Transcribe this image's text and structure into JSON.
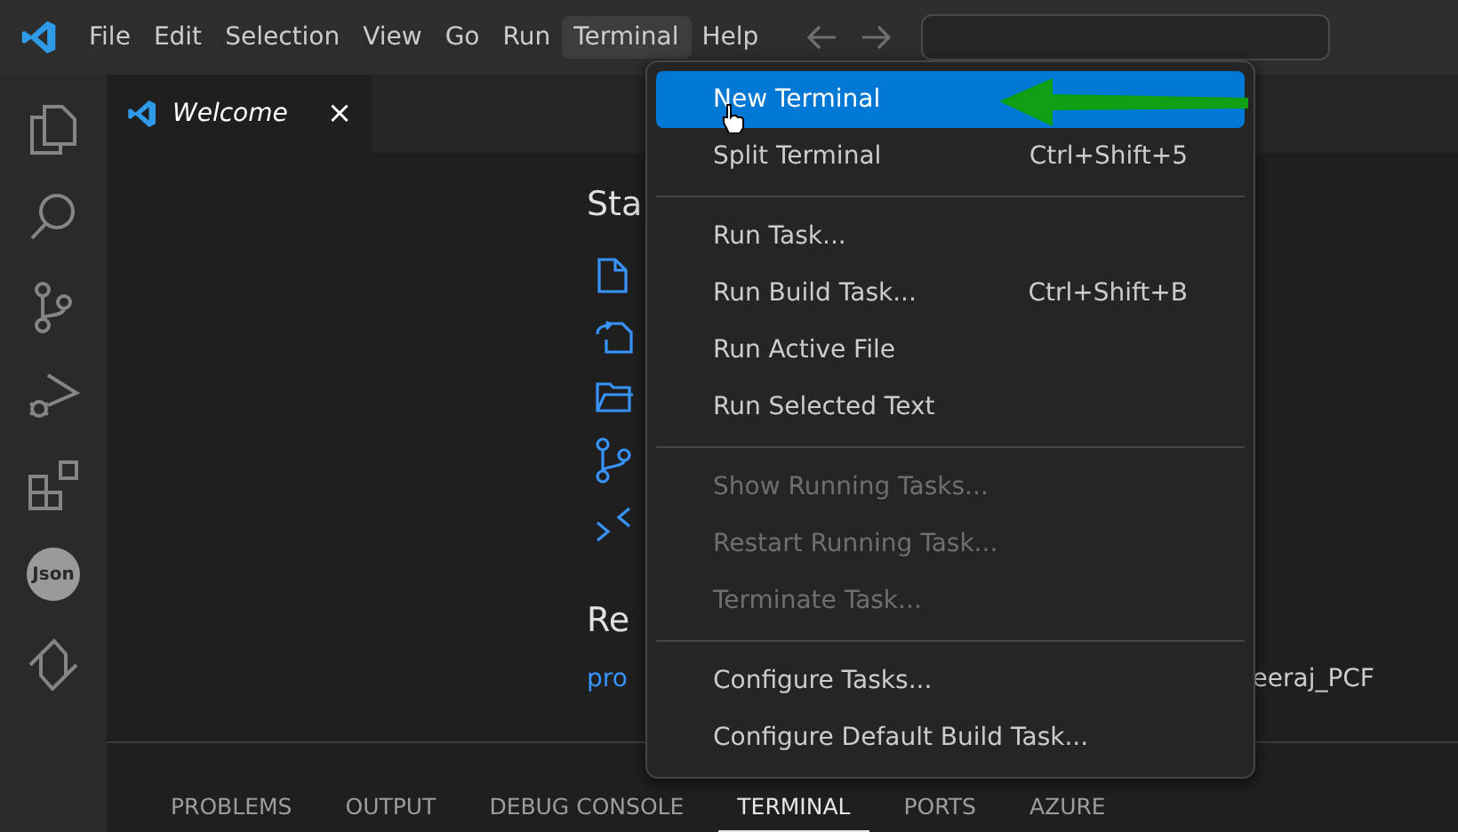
{
  "menubar": [
    {
      "label": "File",
      "selected": false
    },
    {
      "label": "Edit",
      "selected": false
    },
    {
      "label": "Selection",
      "selected": false
    },
    {
      "label": "View",
      "selected": false
    },
    {
      "label": "Go",
      "selected": false
    },
    {
      "label": "Run",
      "selected": false
    },
    {
      "label": "Terminal",
      "selected": true
    },
    {
      "label": "Help",
      "selected": false
    }
  ],
  "activity_badge": "Json",
  "tabs": [
    {
      "label": "Welcome",
      "selected": true,
      "close": "×"
    }
  ],
  "welcome": {
    "start_heading": "Sta",
    "recent_heading": "Re",
    "recent": [
      {
        "name": "pro",
        "path": "eeraj_PCF"
      }
    ]
  },
  "panel_tabs": [
    {
      "label": "PROBLEMS",
      "selected": false
    },
    {
      "label": "OUTPUT",
      "selected": false
    },
    {
      "label": "DEBUG CONSOLE",
      "selected": false
    },
    {
      "label": "TERMINAL",
      "selected": true
    },
    {
      "label": "PORTS",
      "selected": false
    },
    {
      "label": "AZURE",
      "selected": false
    }
  ],
  "terminal_menu": [
    {
      "kind": "item",
      "label": "New Terminal",
      "selected": true,
      "disabled": false
    },
    {
      "kind": "item",
      "label": "Split Terminal",
      "shortcut": "Ctrl+Shift+5",
      "selected": false,
      "disabled": false
    },
    {
      "kind": "separator"
    },
    {
      "kind": "item",
      "label": "Run Task...",
      "selected": false,
      "disabled": false
    },
    {
      "kind": "item",
      "label": "Run Build Task...",
      "shortcut": "Ctrl+Shift+B",
      "selected": false,
      "disabled": false
    },
    {
      "kind": "item",
      "label": "Run Active File",
      "selected": false,
      "disabled": false
    },
    {
      "kind": "item",
      "label": "Run Selected Text",
      "selected": false,
      "disabled": false
    },
    {
      "kind": "separator"
    },
    {
      "kind": "item",
      "label": "Show Running Tasks...",
      "selected": false,
      "disabled": true
    },
    {
      "kind": "item",
      "label": "Restart Running Task...",
      "selected": false,
      "disabled": true
    },
    {
      "kind": "item",
      "label": "Terminate Task...",
      "selected": false,
      "disabled": true
    },
    {
      "kind": "separator"
    },
    {
      "kind": "item",
      "label": "Configure Tasks...",
      "selected": false,
      "disabled": false
    },
    {
      "kind": "item",
      "label": "Configure Default Build Task...",
      "selected": false,
      "disabled": false
    }
  ]
}
